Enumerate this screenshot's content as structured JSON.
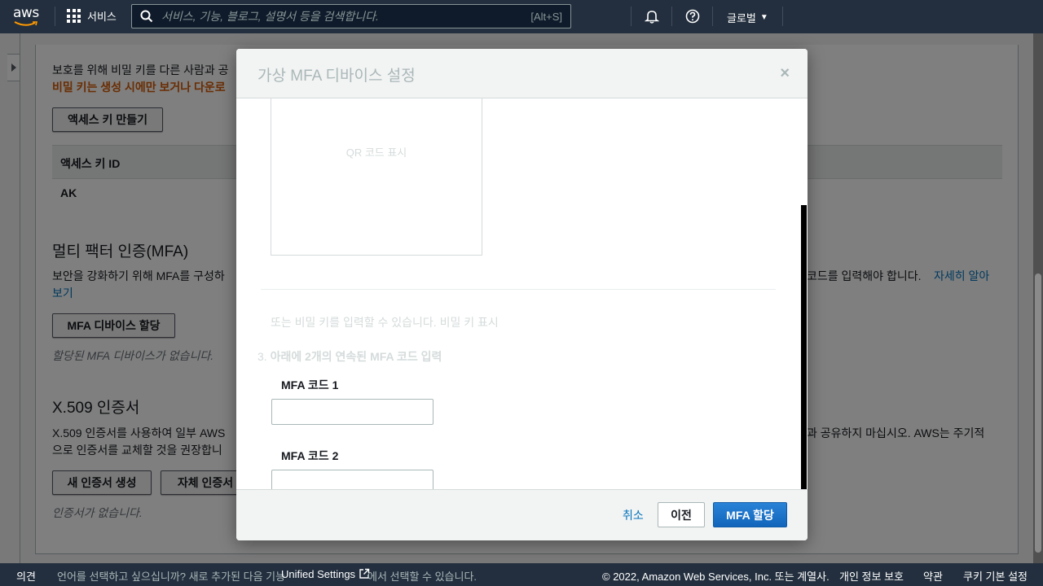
{
  "topnav": {
    "logo_text": "aws",
    "services_label": "서비스",
    "search_placeholder": "서비스, 기능, 블로그, 설명서 등을 검색합니다.",
    "search_shortcut": "[Alt+S]",
    "region_label": "글로벌"
  },
  "page": {
    "access_key_warning": "보호를 위해 비밀 키를 다른 사람과 공",
    "secret_key_note": "비밀 키는 생성 시에만 보거나 다운로",
    "create_access_key_button": "액세스 키 만들기",
    "table_header_access_key_id": "액세스 키 ID",
    "table_row_access_key": "AK",
    "mfa_heading": "멀티 팩터 인증(MFA)",
    "mfa_desc_left": "보안을 강화하기 위해 MFA를 구성하",
    "mfa_desc_right": "코드를 입력해야 합니다.",
    "mfa_learn_more_link": "자세히 알아",
    "mfa_learn_more_link_cont": "보기",
    "assign_mfa_button": "MFA 디바이스 할당",
    "no_mfa_text": "할당된 MFA 디바이스가 없습니다.",
    "x509_heading": "X.509 인증서",
    "x509_desc_left": "X.509 인증서를 사용하여 일부 AWS",
    "x509_desc_right": "과 공유하지 마십시오. AWS는 주기적",
    "x509_desc_line2": "으로 인증서를 교체할 것을 권장합니",
    "new_cert_button": "새 인증서 생성",
    "own_cert_button": "자체 인증서",
    "no_cert_text": "인증서가 없습니다."
  },
  "modal": {
    "title": "가상 MFA 디바이스 설정",
    "close_symbol": "×",
    "qr_placeholder": "QR 코드 표시",
    "secret_key_text": "또는 비밀 키를 입력할 수 있습니다.",
    "secret_key_link": "비밀 키 표시",
    "step3_number": "3.",
    "step3_text": "아래에 2개의 연속된 MFA 코드 입력",
    "mfa_code1_label": "MFA 코드 1",
    "mfa_code1_value": "",
    "mfa_code2_label": "MFA 코드 2",
    "mfa_code2_value": "",
    "cancel_label": "취소",
    "prev_label": "이전",
    "assign_label": "MFA 할당"
  },
  "footer": {
    "feedback": "의견",
    "language_text": "언어를 선택하고 싶으십니까? 새로 추가된 다음 기능",
    "unified_settings": "Unified Settings",
    "language_text_end": "에서 선택할 수 있습니다.",
    "copyright": "© 2022, Amazon Web Services, Inc. 또는 계열사.",
    "privacy": "개인 정보 보호",
    "terms": "약관",
    "cookie_settings": "쿠키 기본 설정"
  },
  "colors": {
    "nav_bg": "#232f3e",
    "link": "#0073bb",
    "primary": "#1166bb",
    "warning": "#d45b07"
  }
}
